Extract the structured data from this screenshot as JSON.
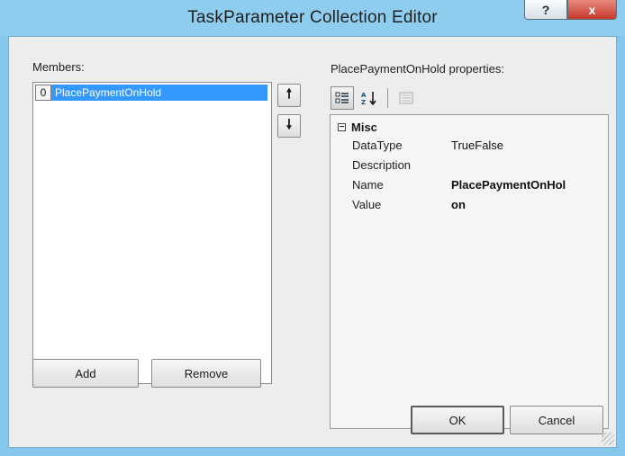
{
  "window": {
    "title": "TaskParameter Collection Editor",
    "help_label": "?",
    "close_label": "x"
  },
  "members": {
    "label": "Members:",
    "items": [
      {
        "index": "0",
        "name": "PlacePaymentOnHold"
      }
    ],
    "move_up_label": "🠕",
    "move_down_label": "🠗",
    "add_label": "Add",
    "remove_label": "Remove"
  },
  "properties": {
    "label": "PlacePaymentOnHold properties:",
    "toolbar": {
      "categorized_icon": "categorized-icon",
      "alphabetical_icon": "alphabetical-icon",
      "property_pages_icon": "property-pages-icon"
    },
    "category": {
      "expander": "−",
      "name": "Misc"
    },
    "rows": [
      {
        "name": "DataType",
        "value": "TrueFalse",
        "bold": false
      },
      {
        "name": "Description",
        "value": "",
        "bold": false
      },
      {
        "name": "Name",
        "value": "PlacePaymentOnHol",
        "bold": true
      },
      {
        "name": "Value",
        "value": "on",
        "bold": true
      }
    ]
  },
  "footer": {
    "ok_label": "OK",
    "cancel_label": "Cancel"
  }
}
